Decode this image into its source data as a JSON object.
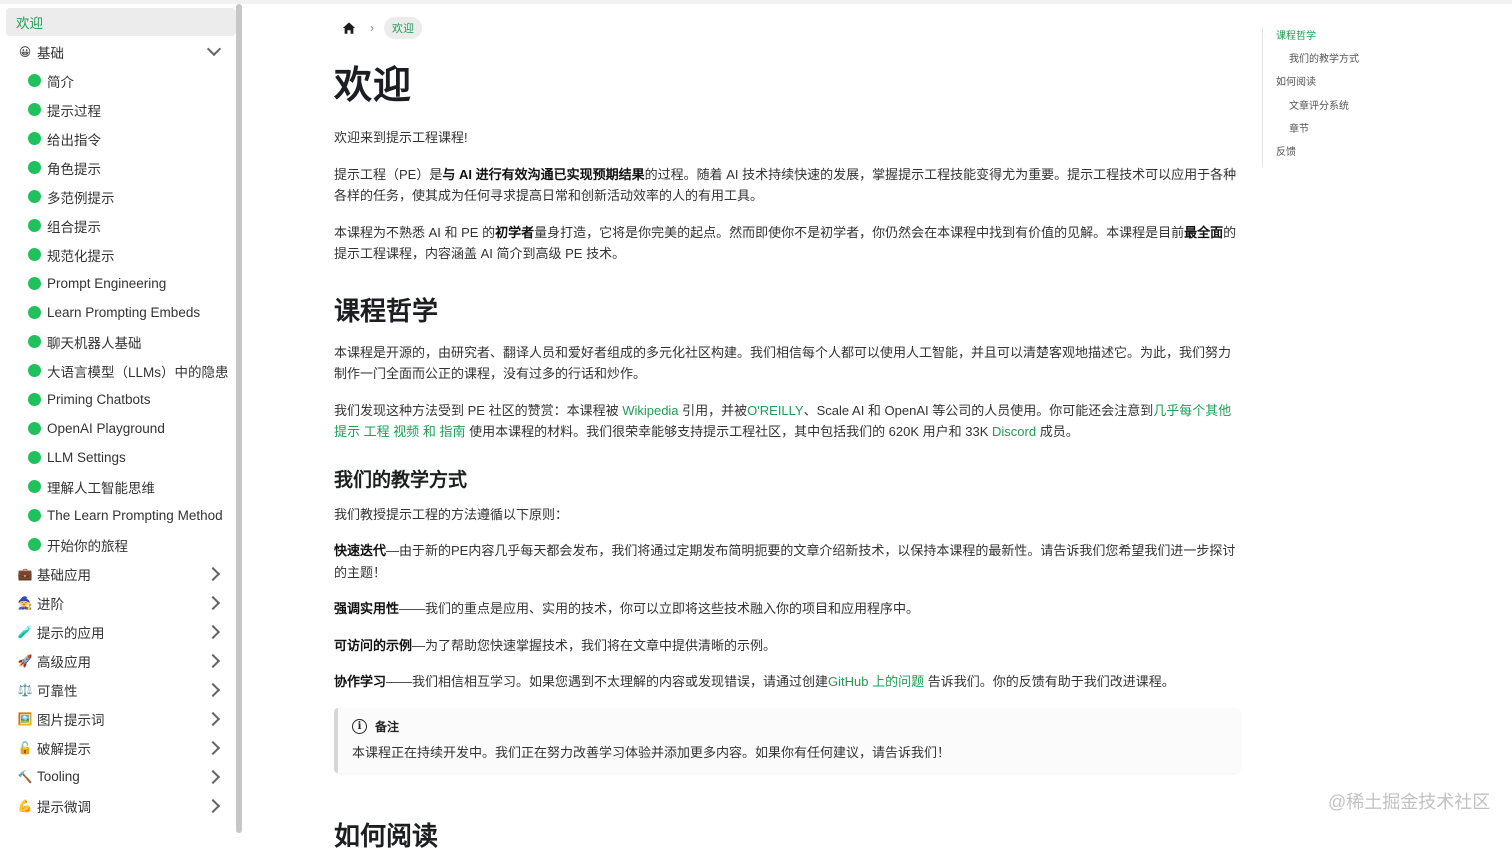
{
  "sidebar": {
    "active": "欢迎",
    "group_open": {
      "icon": "😀",
      "label": "基础"
    },
    "children": [
      "简介",
      "提示过程",
      "给出指令",
      "角色提示",
      "多范例提示",
      "组合提示",
      "规范化提示",
      "Prompt Engineering",
      "Learn Prompting Embeds",
      "聊天机器人基础",
      "大语言模型（LLMs）中的隐患",
      "Priming Chatbots",
      "OpenAI Playground",
      "LLM Settings",
      "理解人工智能思维",
      "The Learn Prompting Method",
      "开始你的旅程"
    ],
    "categories": [
      {
        "icon": "💼",
        "label": "基础应用"
      },
      {
        "icon": "🧙",
        "label": "进阶"
      },
      {
        "icon": "🧪",
        "label": "提示的应用"
      },
      {
        "icon": "🚀",
        "label": "高级应用"
      },
      {
        "icon": "⚖️",
        "label": "可靠性"
      },
      {
        "icon": "🖼️",
        "label": "图片提示词"
      },
      {
        "icon": "🔓",
        "label": "破解提示"
      },
      {
        "icon": "🔨",
        "label": "Tooling"
      },
      {
        "icon": "💪",
        "label": "提示微调"
      }
    ]
  },
  "breadcrumb": {
    "home_icon": "home-icon",
    "current": "欢迎"
  },
  "main": {
    "title": "欢迎",
    "intro": "欢迎来到提示工程课程!",
    "p1": {
      "a": "提示工程（PE）是",
      "b": "与 AI 进行有效沟通已实现预期结果",
      "c": "的过程。随着 AI 技术持续快速的发展，掌握提示工程技能变得尤为重要。提示工程技术可以应用于各种各样的任务，使其成为任何寻求提高日常和创新活动效率的人的有用工具。"
    },
    "p2": {
      "a": "本课程为不熟悉 AI 和 PE 的",
      "b": "初学者",
      "c": "量身打造，它将是你完美的起点。然而即使你不是初学者，你仍然会在本课程中找到有价值的见解。本课程是目前",
      "d": "最全面",
      "e": "的提示工程课程，内容涵盖 AI 简介到高级 PE 技术。"
    },
    "h_philosophy": "课程哲学",
    "p3": "本课程是开源的，由研究者、翻译人员和爱好者组成的多元化社区构建。我们相信每个人都可以使用人工智能，并且可以清楚客观地描述它。为此，我们努力制作一门全面而公正的课程，没有过多的行话和炒作。",
    "p4": {
      "a": "我们发现这种方法受到 PE 社区的赞赏：本课程被 ",
      "wiki": "Wikipedia",
      "b": " 引用，并被",
      "oreilly": "O'REILLY",
      "c": "、Scale AI 和 OpenAI 等公司的人员使用。你可能还会注意到",
      "l1": "几乎每个其他 提示 工程 视频 和 指南",
      "d": " 使用本课程的材料。我们很荣幸能够支持提示工程社区，其中包括我们的 620K 用户和 33K ",
      "discord": "Discord",
      "e": " 成员。"
    },
    "h_teaching": "我们的教学方式",
    "p5": "我们教授提示工程的方法遵循以下原则：",
    "pr1": {
      "b": "快速迭代",
      "t": "—由于新的PE内容几乎每天都会发布，我们将通过定期发布简明扼要的文章介绍新技术，以保持本课程的最新性。请告诉我们您希望我们进一步探讨的主题！"
    },
    "pr2": {
      "b": "强调实用性",
      "t": "——我们的重点是应用、实用的技术，你可以立即将这些技术融入你的项目和应用程序中。"
    },
    "pr3": {
      "b": "可访问的示例",
      "t": "—为了帮助您快速掌握技术，我们将在文章中提供清晰的示例。"
    },
    "pr4": {
      "b": "协作学习",
      "t1": "——我们相信相互学习。如果您遇到不太理解的内容或发现错误，请通过创建",
      "link": "GitHub 上的问题",
      "t2": " 告诉我们。你的反馈有助于我们改进课程。"
    },
    "note": {
      "title": "备注",
      "body": "本课程正在持续开发中。我们正在努力改善学习体验并添加更多内容。如果你有任何建议，请告诉我们！"
    },
    "h_reading_partial": "如何阅读"
  },
  "toc": [
    {
      "label": "课程哲学",
      "level": 1,
      "active": true
    },
    {
      "label": "我们的教学方式",
      "level": 2,
      "active": false
    },
    {
      "label": "如何阅读",
      "level": 1,
      "active": false
    },
    {
      "label": "文章评分系统",
      "level": 2,
      "active": false
    },
    {
      "label": "章节",
      "level": 2,
      "active": false
    },
    {
      "label": "反馈",
      "level": 1,
      "active": false
    }
  ],
  "watermark": "@稀土掘金技术社区",
  "colors": {
    "accent": "#1f9d55",
    "dot": "#20c05c"
  }
}
